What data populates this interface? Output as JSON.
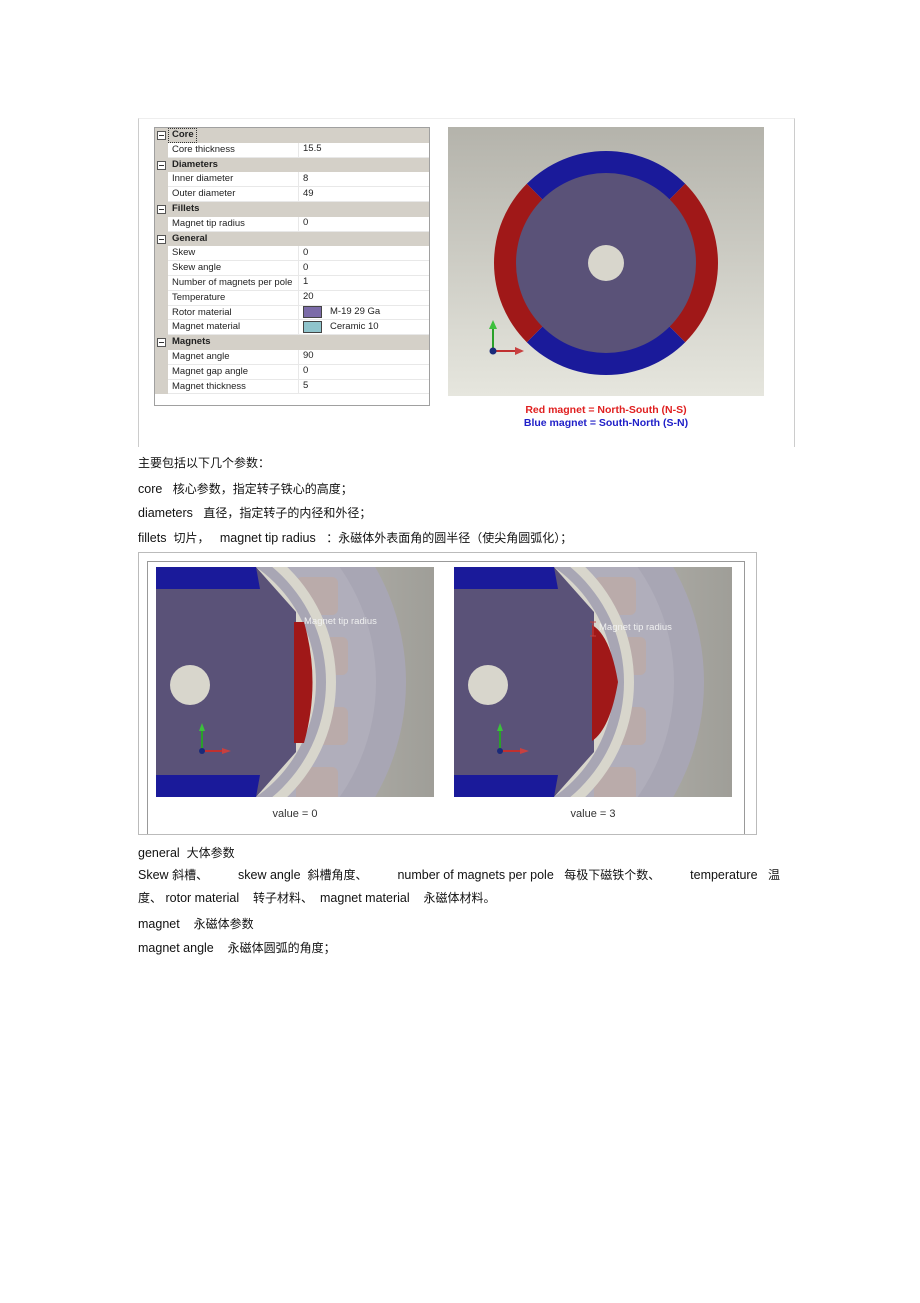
{
  "property_grid": {
    "categories": [
      {
        "name": "Core",
        "rows": [
          {
            "name": "Core thickness",
            "value": "15.5"
          }
        ]
      },
      {
        "name": "Diameters",
        "rows": [
          {
            "name": "Inner diameter",
            "value": "8"
          },
          {
            "name": "Outer diameter",
            "value": "49"
          }
        ]
      },
      {
        "name": "Fillets",
        "rows": [
          {
            "name": "Magnet tip radius",
            "value": "0"
          }
        ]
      },
      {
        "name": "General",
        "rows": [
          {
            "name": "Skew",
            "value": "0"
          },
          {
            "name": "Skew angle",
            "value": "0"
          },
          {
            "name": "Number of magnets per pole",
            "value": "1"
          },
          {
            "name": "Temperature",
            "value": "20"
          },
          {
            "name": "Rotor material",
            "value": "M-19 29 Ga",
            "swatch": "#7b6ba8"
          },
          {
            "name": "Magnet material",
            "value": "Ceramic 10",
            "swatch": "#8fc4cc"
          }
        ]
      },
      {
        "name": "Magnets",
        "rows": [
          {
            "name": "Magnet angle",
            "value": "90"
          },
          {
            "name": "Magnet gap angle",
            "value": "0"
          },
          {
            "name": "Magnet thickness",
            "value": "5"
          }
        ]
      }
    ]
  },
  "rotor_view": {
    "legend_red": "Red magnet = North-South (N-S)",
    "legend_blue": "Blue magnet = South-North (S-N)",
    "colors": {
      "red_magnet": "#a01818",
      "blue_magnet": "#1a1a9a",
      "rotor": "#5a5278",
      "shaft": "#d8d6cc"
    }
  },
  "paragraphs": {
    "intro": "主要包括以下几个参数：",
    "core": {
      "term": "core",
      "desc": "核心参数，指定转子铁心的高度；"
    },
    "diameters": {
      "term": "diameters",
      "desc": "直径，指定转子的内径和外径；"
    },
    "fillets": {
      "term": "fillets",
      "desc1": "切片，",
      "term2": "magnet tip radius",
      "desc2": "：永磁体外表面角的圆半径（使尖角圆弧化）；"
    },
    "general": {
      "term": "general",
      "desc": "大体参数"
    },
    "general_detail_line1": {
      "t1": "Skew",
      "d1": "斜槽、",
      "t2": "skew angle",
      "d2": "斜槽角度、",
      "t3": "number of magnets per pole",
      "d3": "每极下磁铁个数、",
      "t4": "temperature",
      "d4": "温"
    },
    "general_detail_line2": {
      "d0": "度、",
      "t5": "rotor material",
      "d5": "转子材料、",
      "t6": "magnet material",
      "d6": "永磁体材料。"
    },
    "magnet": {
      "term": "magnet",
      "desc": "永磁体参数"
    },
    "magnet_angle": {
      "term": "magnet angle",
      "desc": "永磁体圆弧的角度；"
    }
  },
  "fillet_figure": {
    "annotation": "Magnet tip radius",
    "left_caption": "value = 0",
    "right_caption": "value = 3"
  }
}
